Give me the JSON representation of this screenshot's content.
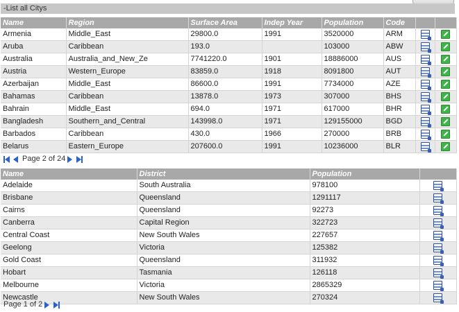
{
  "panel_title": "-List all Citys",
  "countries": {
    "columns": [
      "Name",
      "Region",
      "Surface Area",
      "Indep Year",
      "Population",
      "Code",
      "",
      ""
    ],
    "rows": [
      [
        "Armenia",
        "Middle_East",
        "29800.0",
        "1991",
        "3520000",
        "ARM"
      ],
      [
        "Aruba",
        "Caribbean",
        "193.0",
        "",
        "103000",
        "ABW"
      ],
      [
        "Australia",
        "Australia_and_New_Ze",
        "7741220.0",
        "1901",
        "18886000",
        "AUS"
      ],
      [
        "Austria",
        "Western_Europe",
        "83859.0",
        "1918",
        "8091800",
        "AUT"
      ],
      [
        "Azerbaijan",
        "Middle_East",
        "86600.0",
        "1991",
        "7734000",
        "AZE"
      ],
      [
        "Bahamas",
        "Caribbean",
        "13878.0",
        "1973",
        "307000",
        "BHS"
      ],
      [
        "Bahrain",
        "Middle_East",
        "694.0",
        "1971",
        "617000",
        "BHR"
      ],
      [
        "Bangladesh",
        "Southern_and_Central",
        "143998.0",
        "1971",
        "129155000",
        "BGD"
      ],
      [
        "Barbados",
        "Caribbean",
        "430.0",
        "1966",
        "270000",
        "BRB"
      ],
      [
        "Belarus",
        "Eastern_Europe",
        "207600.0",
        "1991",
        "10236000",
        "BLR"
      ]
    ],
    "pager_text": "Page 2 of 24"
  },
  "cities": {
    "columns": [
      "Name",
      "District",
      "Population",
      ""
    ],
    "rows": [
      [
        "Adelaide",
        "South Australia",
        "978100"
      ],
      [
        "Brisbane",
        "Queensland",
        "1291117"
      ],
      [
        "Cairns",
        "Queensland",
        "92273"
      ],
      [
        "Canberra",
        "Capital Region",
        "322723"
      ],
      [
        "Central Coast",
        "New South Wales",
        "227657"
      ],
      [
        "Geelong",
        "Victoria",
        "125382"
      ],
      [
        "Gold Coast",
        "Queensland",
        "311932"
      ],
      [
        "Hobart",
        "Tasmania",
        "126118"
      ],
      [
        "Melbourne",
        "Victoria",
        "2865329"
      ],
      [
        "Newcastle",
        "New South Wales",
        "270324"
      ]
    ],
    "pager_text": "Page 1 of 2"
  },
  "icons": {
    "view": "view-details-icon",
    "edit": "edit-icon"
  },
  "colors": {
    "header_bg": "#a8a8a8",
    "title_bg": "#c7c7c7",
    "alt_row": "#e9e9e9",
    "pager_arrow": "#2b62c9",
    "edit_green": "#3fb44a"
  }
}
